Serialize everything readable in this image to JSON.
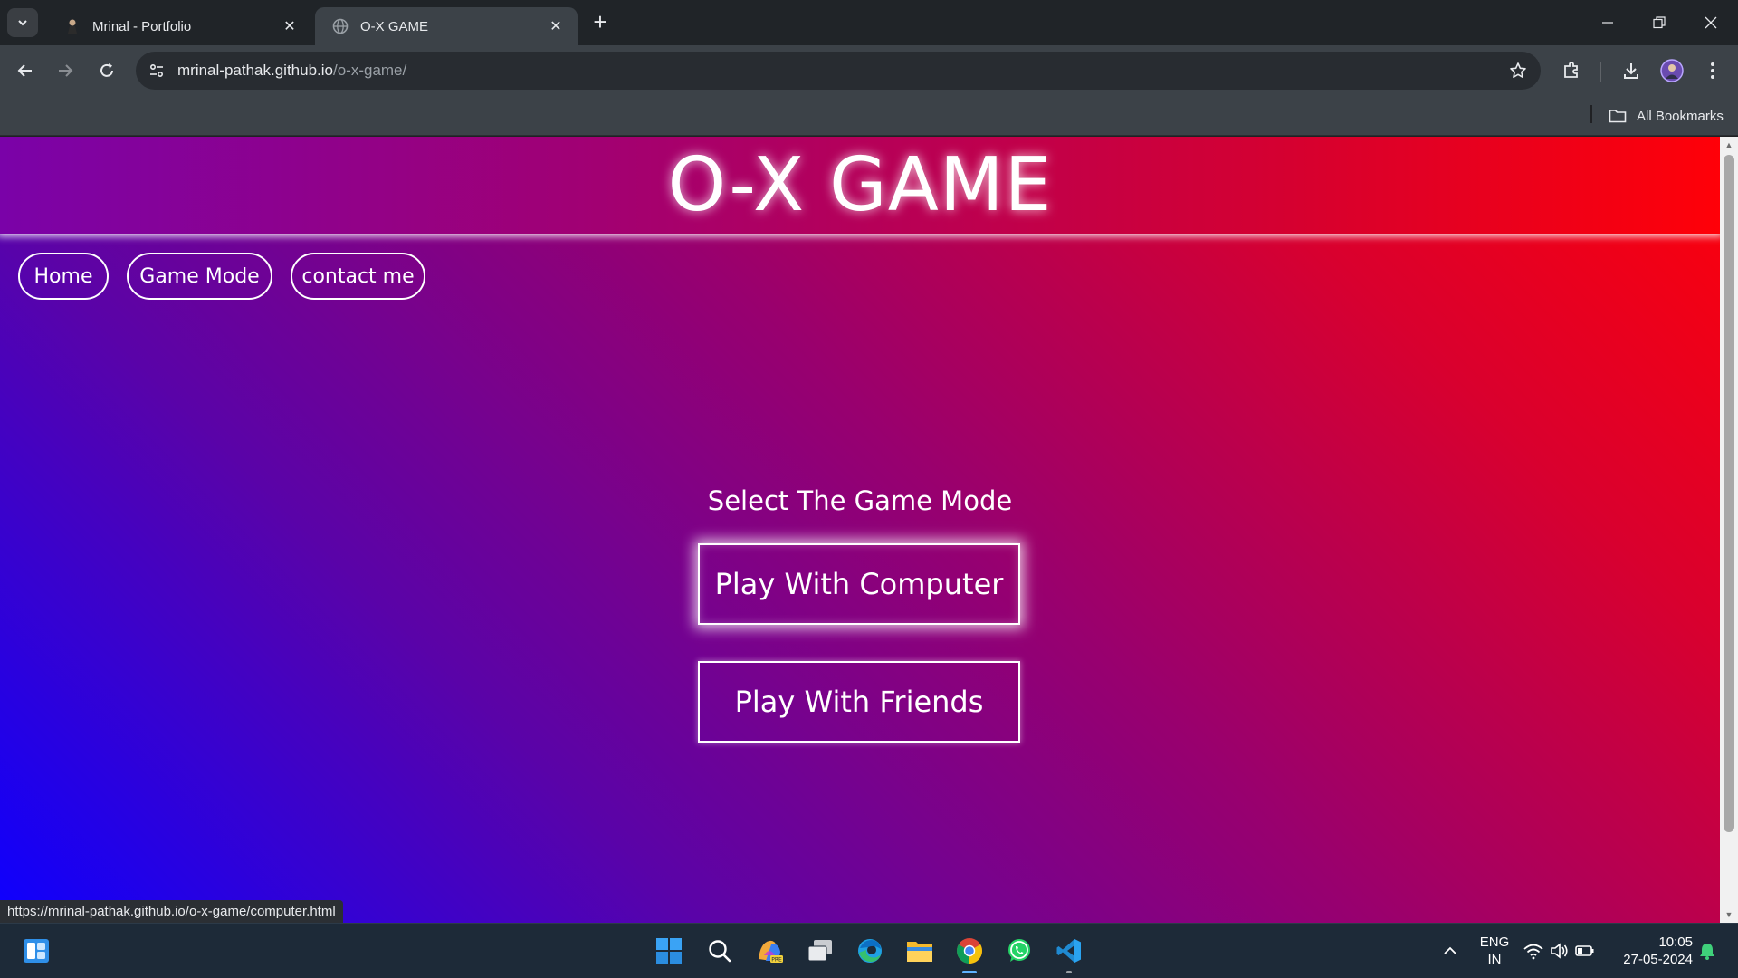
{
  "browser": {
    "tabs": [
      {
        "title": "Mrinal - Portfolio",
        "icon": "person-avatar-favicon",
        "active": false
      },
      {
        "title": "O-X GAME",
        "icon": "globe-favicon",
        "active": true
      }
    ],
    "address": {
      "domain": "mrinal-pathak.github.io",
      "path": "/o-x-game/"
    },
    "bookmarks_label": "All Bookmarks",
    "status_url": "https://mrinal-pathak.github.io/o-x-game/computer.html"
  },
  "page": {
    "title": "O-X GAME",
    "nav": [
      "Home",
      "Game Mode",
      "contact me"
    ],
    "select_label": "Select The Game Mode",
    "buttons": {
      "computer": "Play With Computer",
      "friends": "Play With Friends"
    }
  },
  "taskbar": {
    "lang_line1": "ENG",
    "lang_line2": "IN",
    "time": "10:05",
    "date": "27-05-2024"
  },
  "colors": {
    "gradient_start": "#0d00ff",
    "gradient_end": "#ff0008",
    "chrome_dark": "#202428",
    "chrome_toolbar": "#3c4248",
    "taskbar": "#1d2a38"
  }
}
